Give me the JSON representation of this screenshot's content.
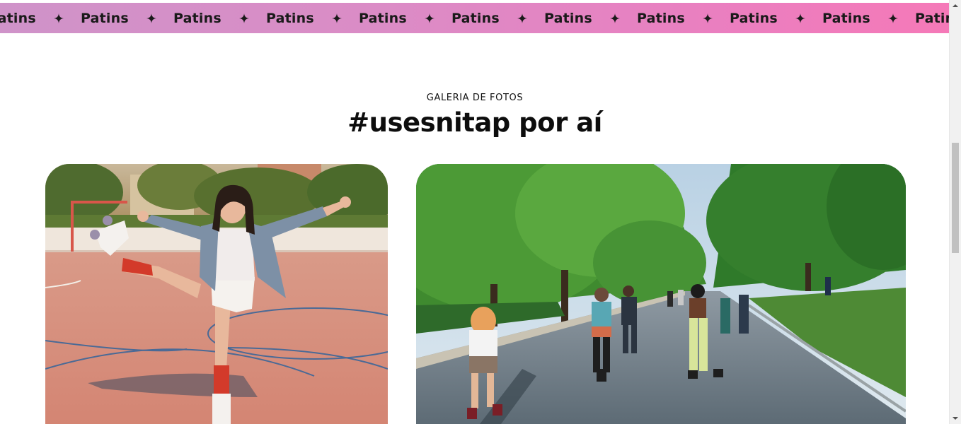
{
  "marquee": {
    "items": [
      "Patins",
      "Patins",
      "Patins",
      "Patins",
      "Patins",
      "Patins",
      "Patins",
      "Patins",
      "Patins",
      "Patins",
      "Patins"
    ],
    "separator_icon": "four-point-star-icon"
  },
  "gallery": {
    "eyebrow": "GALERIA DE FOTOS",
    "title": "#usesnitap por aí",
    "photos": [
      {
        "name": "photo-skater-kick",
        "subject": "woman on roller skates kicking on a sports court"
      },
      {
        "name": "photo-park-skaters",
        "subject": "group of people roller skating on a tree-lined park path"
      }
    ]
  },
  "colors": {
    "marquee_start": "#cf93c9",
    "marquee_end": "#f579b8",
    "text": "#0d0d0d"
  }
}
